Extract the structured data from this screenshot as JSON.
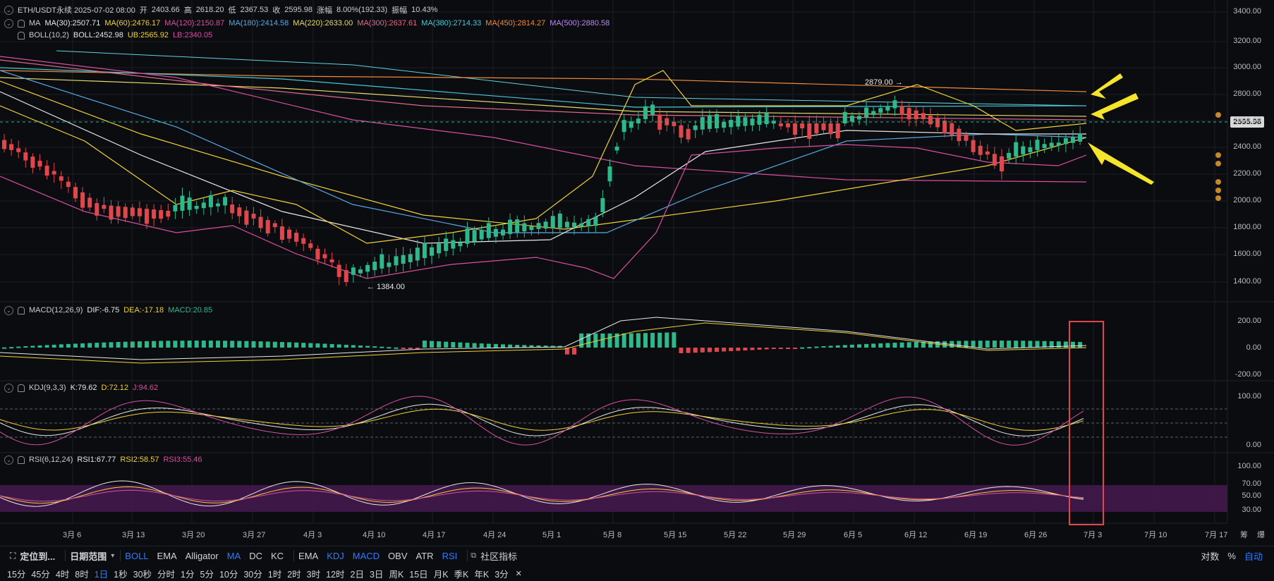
{
  "header": {
    "symbol_line": "ETH/USDT永续 2025-07-02 08:00",
    "open_label": "开",
    "open": "2403.66",
    "high_label": "高",
    "high": "2618.20",
    "low_label": "低",
    "low": "2367.53",
    "close_label": "收",
    "close": "2595.98",
    "change_label": "涨幅",
    "change": "8.00%(192.33)",
    "amp_label": "振幅",
    "amp": "10.43%"
  },
  "ma_legend": {
    "name": "MA",
    "items": [
      {
        "text": "MA(30):2507.71",
        "color": "#e8e8e8"
      },
      {
        "text": "MA(60):2476.17",
        "color": "#f0d13a"
      },
      {
        "text": "MA(120):2150.87",
        "color": "#d94fa0"
      },
      {
        "text": "MA(180):2414.58",
        "color": "#5aa8e6"
      },
      {
        "text": "MA(220):2633.00",
        "color": "#e6d96a"
      },
      {
        "text": "MA(300):2637.61",
        "color": "#e46a8c"
      },
      {
        "text": "MA(380):2714.33",
        "color": "#45c8d6"
      },
      {
        "text": "MA(450):2814.27",
        "color": "#f08a3a"
      },
      {
        "text": "MA(500):2880.58",
        "color": "#b98af0"
      }
    ]
  },
  "boll_legend": {
    "name": "BOLL(10,2)",
    "items": [
      {
        "text": "BOLL:2452.98",
        "color": "#e8e8e8"
      },
      {
        "text": "UB:2565.92",
        "color": "#f0d13a"
      },
      {
        "text": "LB:2340.05",
        "color": "#d94fa0"
      }
    ]
  },
  "macd_legend": {
    "name": "MACD(12,26,9)",
    "items": [
      {
        "text": "DIF:-6.75",
        "color": "#e8e8e8"
      },
      {
        "text": "DEA:-17.18",
        "color": "#f0d13a"
      },
      {
        "text": "MACD:20.85",
        "color": "#2fb88a"
      }
    ]
  },
  "kdj_legend": {
    "name": "KDJ(9,3,3)",
    "items": [
      {
        "text": "K:79.62",
        "color": "#e8e8e8"
      },
      {
        "text": "D:72.12",
        "color": "#f0d13a"
      },
      {
        "text": "J:94.62",
        "color": "#d94fa0"
      }
    ]
  },
  "rsi_legend": {
    "name": "RSI(6,12,24)",
    "items": [
      {
        "text": "RSI1:67.77",
        "color": "#e8e8e8"
      },
      {
        "text": "RSI2:58.57",
        "color": "#f0d13a"
      },
      {
        "text": "RSI3:55.46",
        "color": "#d94fa0"
      }
    ]
  },
  "price_axis": [
    "3400.00",
    "3200.00",
    "3000.00",
    "2800.00",
    "2600.00",
    "2400.00",
    "2200.00",
    "2000.00",
    "1800.00",
    "1600.00",
    "1400.00"
  ],
  "last_price": "2595.98",
  "high_mark": "2879.00 →",
  "low_mark": "← 1384.00",
  "macd_axis": [
    "200.00",
    "0.00",
    "-200.00"
  ],
  "kdj_axis": [
    "100.00",
    "0.00"
  ],
  "rsi_axis": [
    "100.00",
    "70.00",
    "50.00",
    "30.00"
  ],
  "x_axis": [
    "3月 6",
    "3月 13",
    "3月 20",
    "3月 27",
    "4月 3",
    "4月 10",
    "4月 17",
    "4月 24",
    "5月 1",
    "5月 8",
    "5月 15",
    "5月 22",
    "5月 29",
    "6月 5",
    "6月 12",
    "6月 19",
    "6月 26",
    "7月 3",
    "7月 10",
    "7月 17"
  ],
  "corner_labels": [
    "筹",
    "爆"
  ],
  "toolbar": {
    "locate": "定位到...",
    "date_range": "日期范围",
    "main_indicators": [
      "BOLL",
      "EMA",
      "Alligator",
      "MA",
      "DC",
      "KC"
    ],
    "sub_indicators": [
      "EMA",
      "KDJ",
      "MACD",
      "OBV",
      "ATR",
      "RSI"
    ],
    "community": "社区指标",
    "log_label": "对数",
    "pct_label": "%",
    "auto_label": "自动"
  },
  "timeframes": [
    "15分",
    "45分",
    "4时",
    "8时",
    "1日",
    "1秒",
    "30秒",
    "分时",
    "1分",
    "5分",
    "10分",
    "30分",
    "1时",
    "2时",
    "3时",
    "12时",
    "2日",
    "3日",
    "周K",
    "15日",
    "月K",
    "季K",
    "年K",
    "3分"
  ],
  "active_timeframe": "1日",
  "colors": {
    "up": "#2fb88a",
    "down": "#e0474c",
    "accent": "#2f7bff",
    "arrow": "#f5e52a",
    "box": "#e0474c"
  }
}
